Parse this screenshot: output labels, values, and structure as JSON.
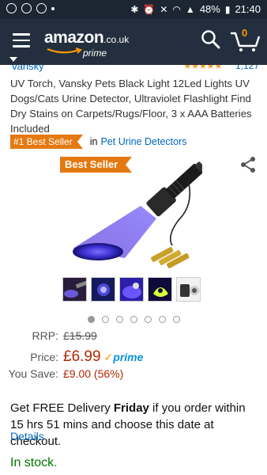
{
  "status_bar": {
    "battery": "48%",
    "time": "21:40"
  },
  "header": {
    "logo_word": "amazon",
    "logo_tld": ".co.uk",
    "logo_sub": "prime",
    "cart_count": "0"
  },
  "product": {
    "brand": "Vansky",
    "rating_count": "1,127",
    "title": "UV Torch, Vansky Pets Black Light 12Led Lights UV Dogs/Cats Urine Detector, Ultraviolet Flashlight Find Dry Stains on Carpets/Rugs/Floor, 3 x AAA Batteries Included",
    "best_seller_badge": "#1 Best Seller",
    "in_label": "in",
    "category": "Pet Urine Detectors",
    "image_badge": "Best Seller",
    "gallery_pages": 7,
    "gallery_active": 0
  },
  "pricing": {
    "rrp_label": "RRP:",
    "rrp_value": "£15.99",
    "price_label": "Price:",
    "price_value": "£6.99",
    "prime_text": "prime",
    "save_label": "You Save:",
    "save_value": "£9.00 (56%)"
  },
  "delivery": {
    "prefix": "Get FREE Delivery ",
    "day": "Friday",
    "suffix": " if you order within 15 hrs 51 mins and choose this date at checkout.",
    "details_link": "Details"
  },
  "stock": {
    "status": "In stock."
  },
  "colors": {
    "header_bg": "#232f3e",
    "accent_orange": "#e47911",
    "link_blue": "#0066c0",
    "price_red": "#b12704",
    "stock_green": "#007600",
    "prime_blue": "#0a91d8"
  }
}
